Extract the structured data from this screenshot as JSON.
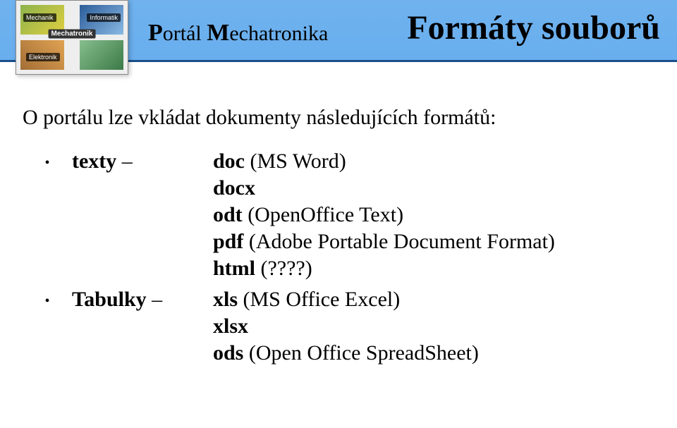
{
  "header": {
    "brand_prefix": "P",
    "brand_word1_rest": "ortál ",
    "brand_m": "M",
    "brand_word2_rest": "echatronika",
    "title": "Formáty souborů",
    "logo_labels": {
      "a": "Mechanik",
      "b": "Informatik",
      "c": "Elektronik",
      "d": "Mechatronik"
    }
  },
  "intro": "O portálu lze vkládat dokumenty následujících formátů:",
  "groups": {
    "texts": {
      "label": "texty",
      "dash": " – ",
      "items": [
        {
          "name": "doc",
          "desc": " (MS Word)"
        },
        {
          "name": "docx",
          "desc": ""
        },
        {
          "name": "odt",
          "desc": " (OpenOffice Text)"
        },
        {
          "name": "pdf",
          "desc": " (Adobe Portable Document Format)"
        },
        {
          "name": "html",
          "desc": " (????)"
        }
      ]
    },
    "tables": {
      "label": "Tabulky",
      "dash": " – ",
      "items": [
        {
          "name": "xls",
          "desc": " (MS Office Excel)"
        },
        {
          "name": "xlsx",
          "desc": ""
        },
        {
          "name": "ods",
          "desc": " (Open Office SpreadSheet)"
        }
      ]
    }
  }
}
